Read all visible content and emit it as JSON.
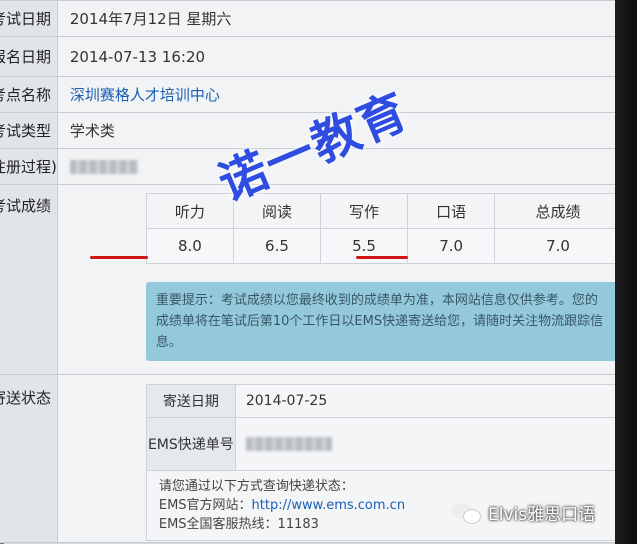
{
  "labels": {
    "exam_date": "考试日期",
    "reg_date": "报名日期",
    "test_center": "考点名称",
    "exam_type": "考试类型",
    "reg_process": "注册过程)",
    "scores": "考试成绩",
    "send_status": "寄送状态"
  },
  "values": {
    "exam_date": "2014年7月12日 星期六",
    "reg_date": "2014-07-13 16:20",
    "test_center": "深圳赛格人才培训中心",
    "exam_type": "学术类"
  },
  "scores": {
    "headers": [
      "听力",
      "阅读",
      "写作",
      "口语",
      "总成绩"
    ],
    "values": [
      "8.0",
      "6.5",
      "5.5",
      "7.0",
      "7.0"
    ]
  },
  "notice": "重要提示：考试成绩以您最终收到的成绩单为准，本网站信息仅供参考。您的成绩单将在笔试后第10个工作日以EMS快递寄送给您，请随时关注物流跟踪信息。",
  "send": {
    "date_label": "寄送日期",
    "date_value": "2014-07-25",
    "ems_label": "EMS快递单号",
    "query_intro": "请您通过以下方式查询快递状态：",
    "website_label": "EMS官方网站：",
    "website_url": "http://www.ems.com.cn",
    "hotline": "EMS全国客服热线：11183"
  },
  "watermark": "诺一教育",
  "brand": "Elvis雅思口语",
  "colors": {
    "link": "#1a5fb4",
    "underline": "#d01515",
    "watermark": "#2f4de0",
    "notice_bg": "#8fc7da"
  }
}
